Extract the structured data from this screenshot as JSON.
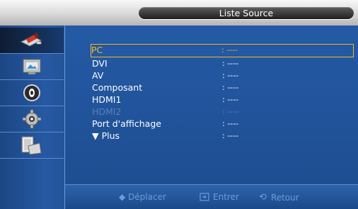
{
  "header": {
    "title": "Liste Source"
  },
  "sidebar": {
    "items": [
      {
        "name": "input-icon"
      },
      {
        "name": "picture-icon"
      },
      {
        "name": "sound-icon"
      },
      {
        "name": "setup-icon"
      },
      {
        "name": "multi-control-icon"
      }
    ]
  },
  "source_list": {
    "items": [
      {
        "label": "PC",
        "value": ": ----",
        "state": "selected"
      },
      {
        "label": "DVI",
        "value": ": ----",
        "state": "normal"
      },
      {
        "label": "AV",
        "value": ": ----",
        "state": "normal"
      },
      {
        "label": "Composant",
        "value": ": ----",
        "state": "normal"
      },
      {
        "label": "HDMI1",
        "value": ": ----",
        "state": "normal"
      },
      {
        "label": "HDMI2",
        "value": ": ----",
        "state": "disabled"
      },
      {
        "label": "Port d'affichage",
        "value": ": ----",
        "state": "normal"
      },
      {
        "label": "▼ Plus",
        "value": ": ----",
        "state": "normal"
      }
    ]
  },
  "footer": {
    "move": "◆ Déplacer",
    "enter": "Entrer",
    "back": "Retour"
  },
  "colors": {
    "background": "#1f4c8c",
    "selection": "#f3b727",
    "disabled_text": "#5c7fb5",
    "hint_text": "#6f9bd8"
  }
}
